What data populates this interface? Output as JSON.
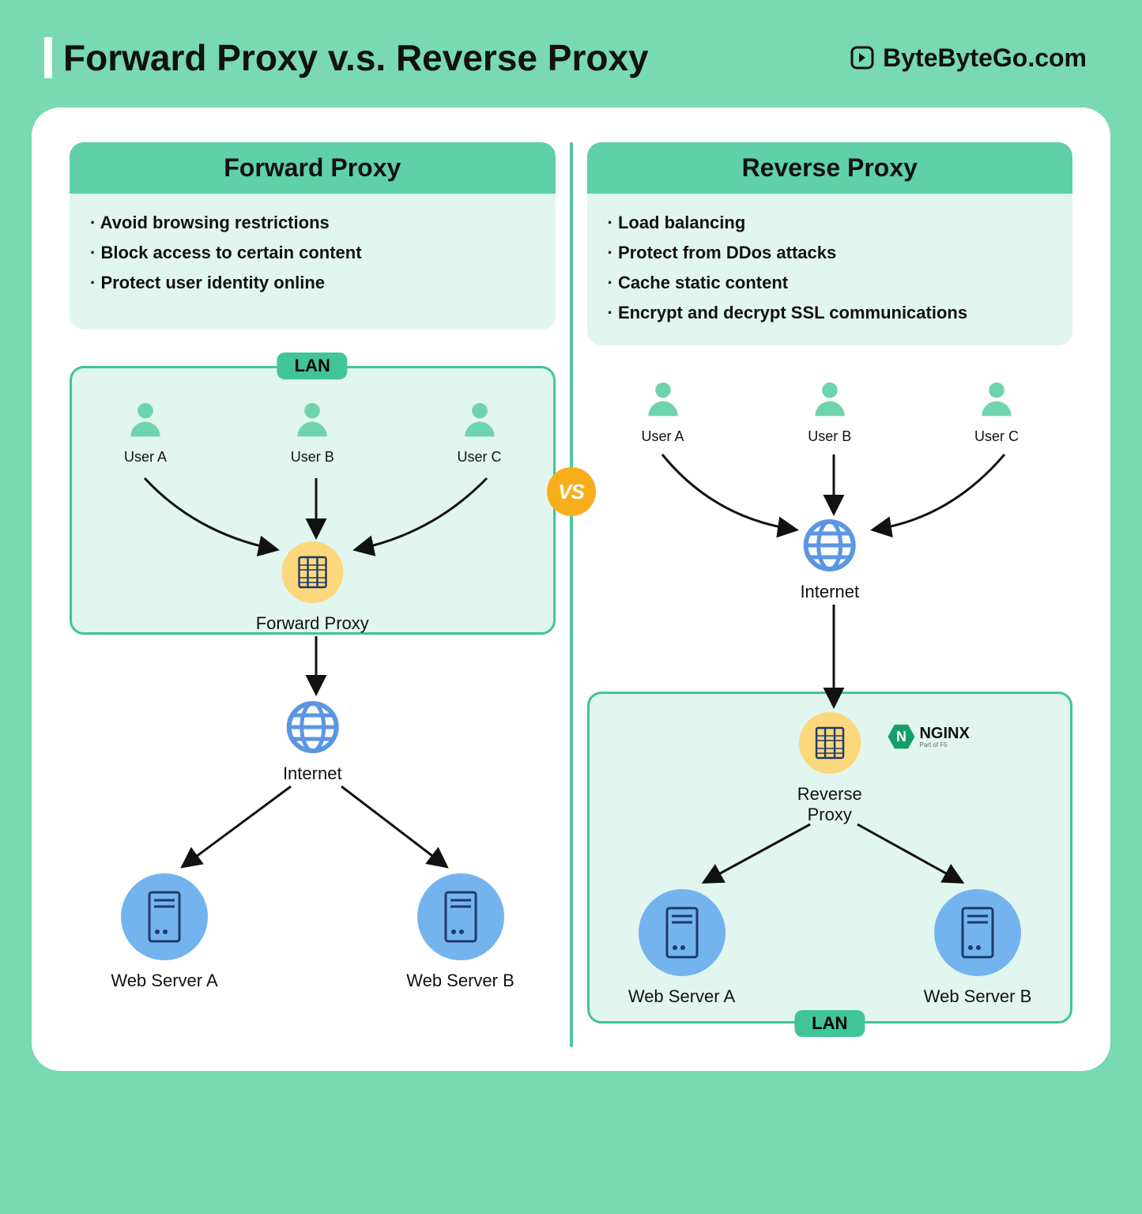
{
  "title": "Forward Proxy v.s. Reverse Proxy",
  "brand": "ByteByteGo.com",
  "vs": "VS",
  "lan_label": "LAN",
  "forward": {
    "heading": "Forward Proxy",
    "bullets": [
      "· Avoid browsing restrictions",
      "· Block access to certain content",
      "· Protect user identity online"
    ],
    "users": [
      "User A",
      "User B",
      "User C"
    ],
    "proxy_label": "Forward Proxy",
    "internet_label": "Internet",
    "servers": [
      "Web Server A",
      "Web Server B"
    ]
  },
  "reverse": {
    "heading": "Reverse Proxy",
    "bullets": [
      "· Load balancing",
      "· Protect from DDos attacks",
      "· Cache static content",
      "· Encrypt and decrypt SSL communications"
    ],
    "users": [
      "User A",
      "User B",
      "User C"
    ],
    "internet_label": "Internet",
    "proxy_label": "Reverse\nProxy",
    "nginx": "NGINX",
    "nginx_sub": "Part of F5",
    "servers": [
      "Web Server A",
      "Web Server B"
    ]
  }
}
